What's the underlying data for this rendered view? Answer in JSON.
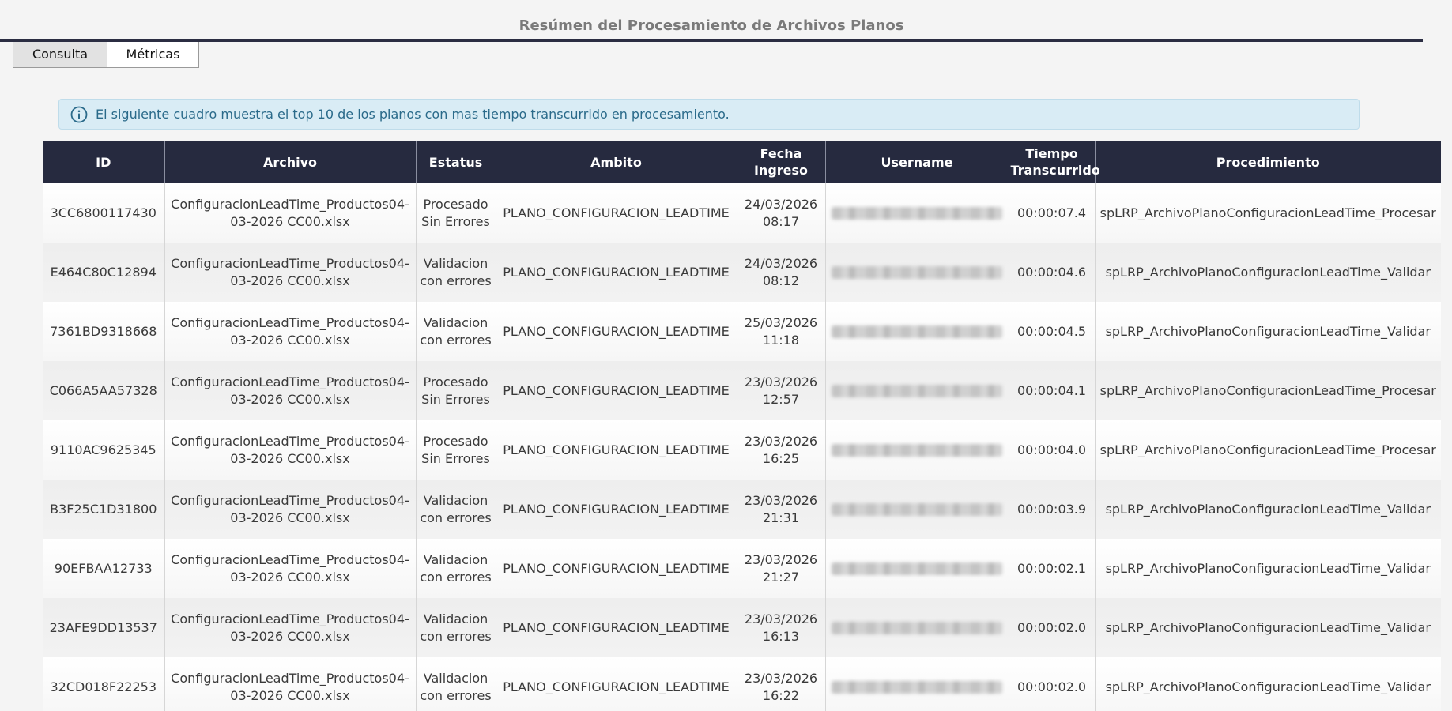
{
  "page_title": "Resúmen del Procesamiento de Archivos Planos",
  "tabs": [
    {
      "label": "Consulta",
      "active": false
    },
    {
      "label": "Métricas",
      "active": true
    }
  ],
  "info_alert": {
    "icon": "info-icon",
    "text": "El siguiente cuadro muestra el top 10 de los planos con mas tiempo transcurrido en procesamiento.",
    "color": "#2a6a8a",
    "background": "#d9ecf5"
  },
  "table": {
    "header_background": "#262a3f",
    "columns": [
      "ID",
      "Archivo",
      "Estatus",
      "Ambito",
      "Fecha Ingreso",
      "Username",
      "Tiempo Transcurrido",
      "Procedimiento"
    ],
    "rows": [
      {
        "id": "3CC6800117430",
        "archivo": "ConfiguracionLeadTime_Productos04-03-2026 CC00.xlsx",
        "estatus": "Procesado Sin Errores",
        "ambito": "PLANO_CONFIGURACION_LEADTIME",
        "fecha": "24/03/2026 08:17",
        "tiempo": "00:00:07.4",
        "procedimiento": "spLRP_ArchivoPlanoConfiguracionLeadTime_Procesar"
      },
      {
        "id": "E464C80C12894",
        "archivo": "ConfiguracionLeadTime_Productos04-03-2026 CC00.xlsx",
        "estatus": "Validacion con errores",
        "ambito": "PLANO_CONFIGURACION_LEADTIME",
        "fecha": "24/03/2026 08:12",
        "tiempo": "00:00:04.6",
        "procedimiento": "spLRP_ArchivoPlanoConfiguracionLeadTime_Validar"
      },
      {
        "id": "7361BD9318668",
        "archivo": "ConfiguracionLeadTime_Productos04-03-2026 CC00.xlsx",
        "estatus": "Validacion con errores",
        "ambito": "PLANO_CONFIGURACION_LEADTIME",
        "fecha": "25/03/2026 11:18",
        "tiempo": "00:00:04.5",
        "procedimiento": "spLRP_ArchivoPlanoConfiguracionLeadTime_Validar"
      },
      {
        "id": "C066A5AA57328",
        "archivo": "ConfiguracionLeadTime_Productos04-03-2026 CC00.xlsx",
        "estatus": "Procesado Sin Errores",
        "ambito": "PLANO_CONFIGURACION_LEADTIME",
        "fecha": "23/03/2026 12:57",
        "tiempo": "00:00:04.1",
        "procedimiento": "spLRP_ArchivoPlanoConfiguracionLeadTime_Procesar"
      },
      {
        "id": "9110AC9625345",
        "archivo": "ConfiguracionLeadTime_Productos04-03-2026 CC00.xlsx",
        "estatus": "Procesado Sin Errores",
        "ambito": "PLANO_CONFIGURACION_LEADTIME",
        "fecha": "23/03/2026 16:25",
        "tiempo": "00:00:04.0",
        "procedimiento": "spLRP_ArchivoPlanoConfiguracionLeadTime_Procesar"
      },
      {
        "id": "B3F25C1D31800",
        "archivo": "ConfiguracionLeadTime_Productos04-03-2026 CC00.xlsx",
        "estatus": "Validacion con errores",
        "ambito": "PLANO_CONFIGURACION_LEADTIME",
        "fecha": "23/03/2026 21:31",
        "tiempo": "00:00:03.9",
        "procedimiento": "spLRP_ArchivoPlanoConfiguracionLeadTime_Validar"
      },
      {
        "id": "90EFBAA12733",
        "archivo": "ConfiguracionLeadTime_Productos04-03-2026 CC00.xlsx",
        "estatus": "Validacion con errores",
        "ambito": "PLANO_CONFIGURACION_LEADTIME",
        "fecha": "23/03/2026 21:27",
        "tiempo": "00:00:02.1",
        "procedimiento": "spLRP_ArchivoPlanoConfiguracionLeadTime_Validar"
      },
      {
        "id": "23AFE9DD13537",
        "archivo": "ConfiguracionLeadTime_Productos04-03-2026 CC00.xlsx",
        "estatus": "Validacion con errores",
        "ambito": "PLANO_CONFIGURACION_LEADTIME",
        "fecha": "23/03/2026 16:13",
        "tiempo": "00:00:02.0",
        "procedimiento": "spLRP_ArchivoPlanoConfiguracionLeadTime_Validar"
      },
      {
        "id": "32CD018F22253",
        "archivo": "ConfiguracionLeadTime_Productos04-03-2026 CC00.xlsx",
        "estatus": "Validacion con errores",
        "ambito": "PLANO_CONFIGURACION_LEADTIME",
        "fecha": "23/03/2026 16:22",
        "tiempo": "00:00:02.0",
        "procedimiento": "spLRP_ArchivoPlanoConfiguracionLeadTime_Validar"
      }
    ]
  }
}
